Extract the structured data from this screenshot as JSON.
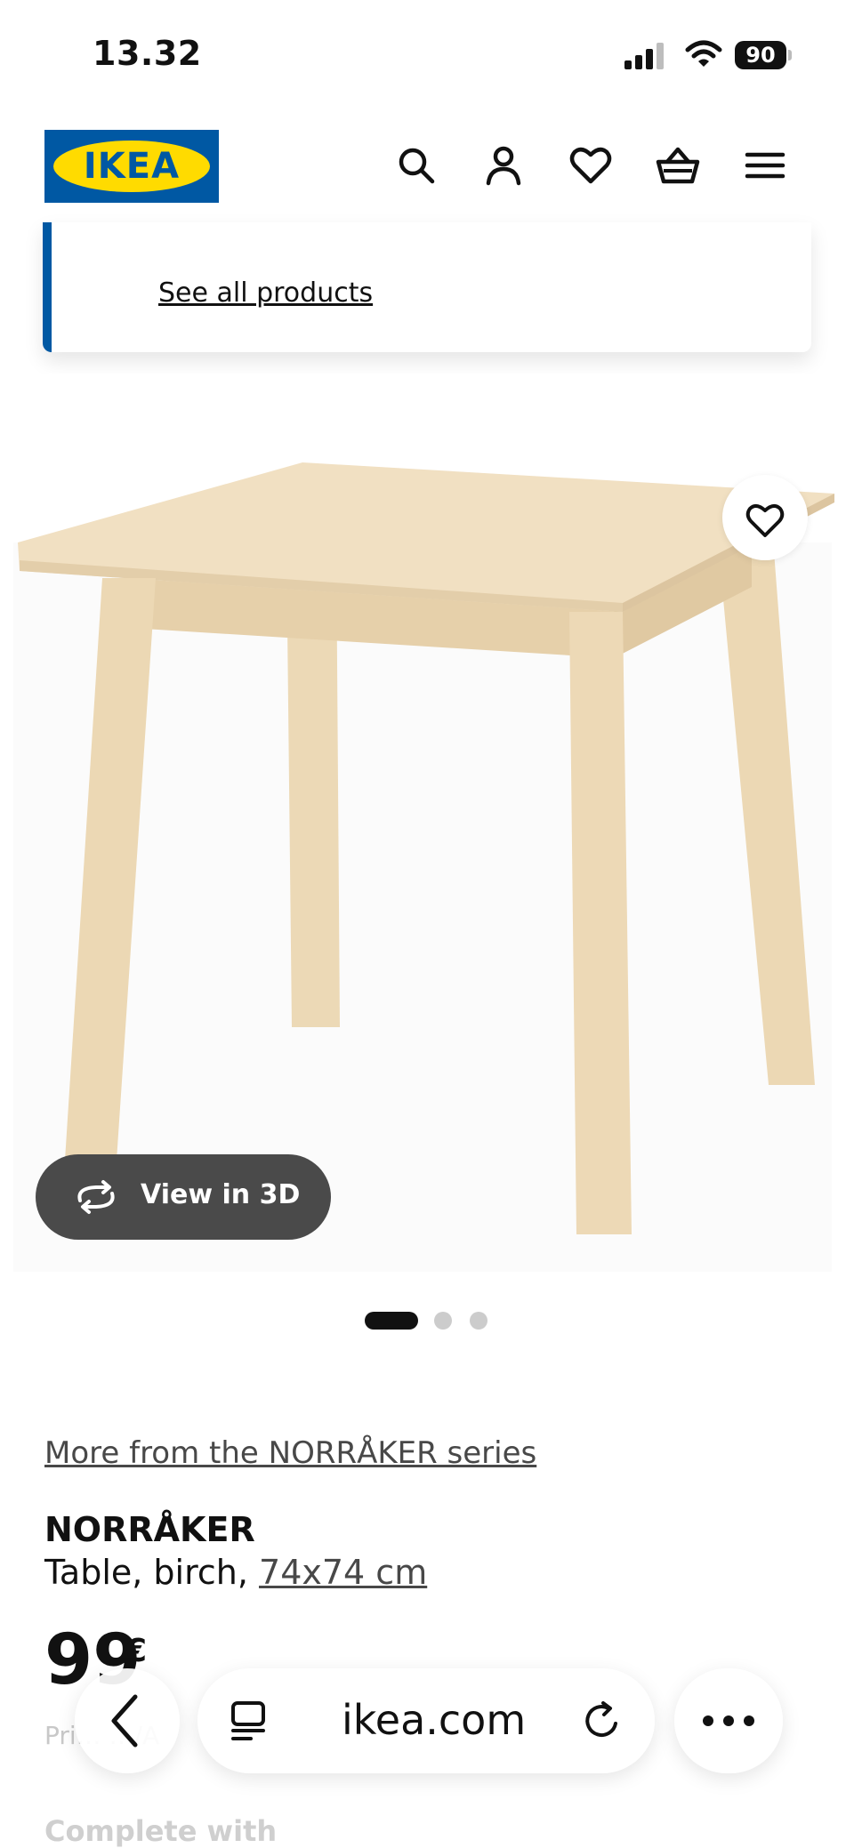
{
  "status_bar": {
    "time": "13.32",
    "battery": "90"
  },
  "header": {
    "logo_text": "IKEA",
    "icons": [
      "search-icon",
      "user-icon",
      "heart-icon",
      "basket-icon",
      "menu-icon"
    ]
  },
  "dropdown": {
    "see_all": "See all products"
  },
  "gallery": {
    "view_3d": "View in 3D",
    "images_count": 3,
    "active_index": 0
  },
  "product": {
    "series_link": "More from the NORRÅKER series",
    "name": "NORRÅKER",
    "desc_prefix": "Table, birch, ",
    "size": "74x74 cm",
    "price_whole": "99",
    "price_currency": "€",
    "price_note": "Pri… …/A",
    "complete_with": "Complete with"
  },
  "browser": {
    "url": "ikea.com"
  },
  "colors": {
    "brand_blue": "#0058a3",
    "brand_yellow": "#ffdb00",
    "wood": "#efdcbc"
  }
}
